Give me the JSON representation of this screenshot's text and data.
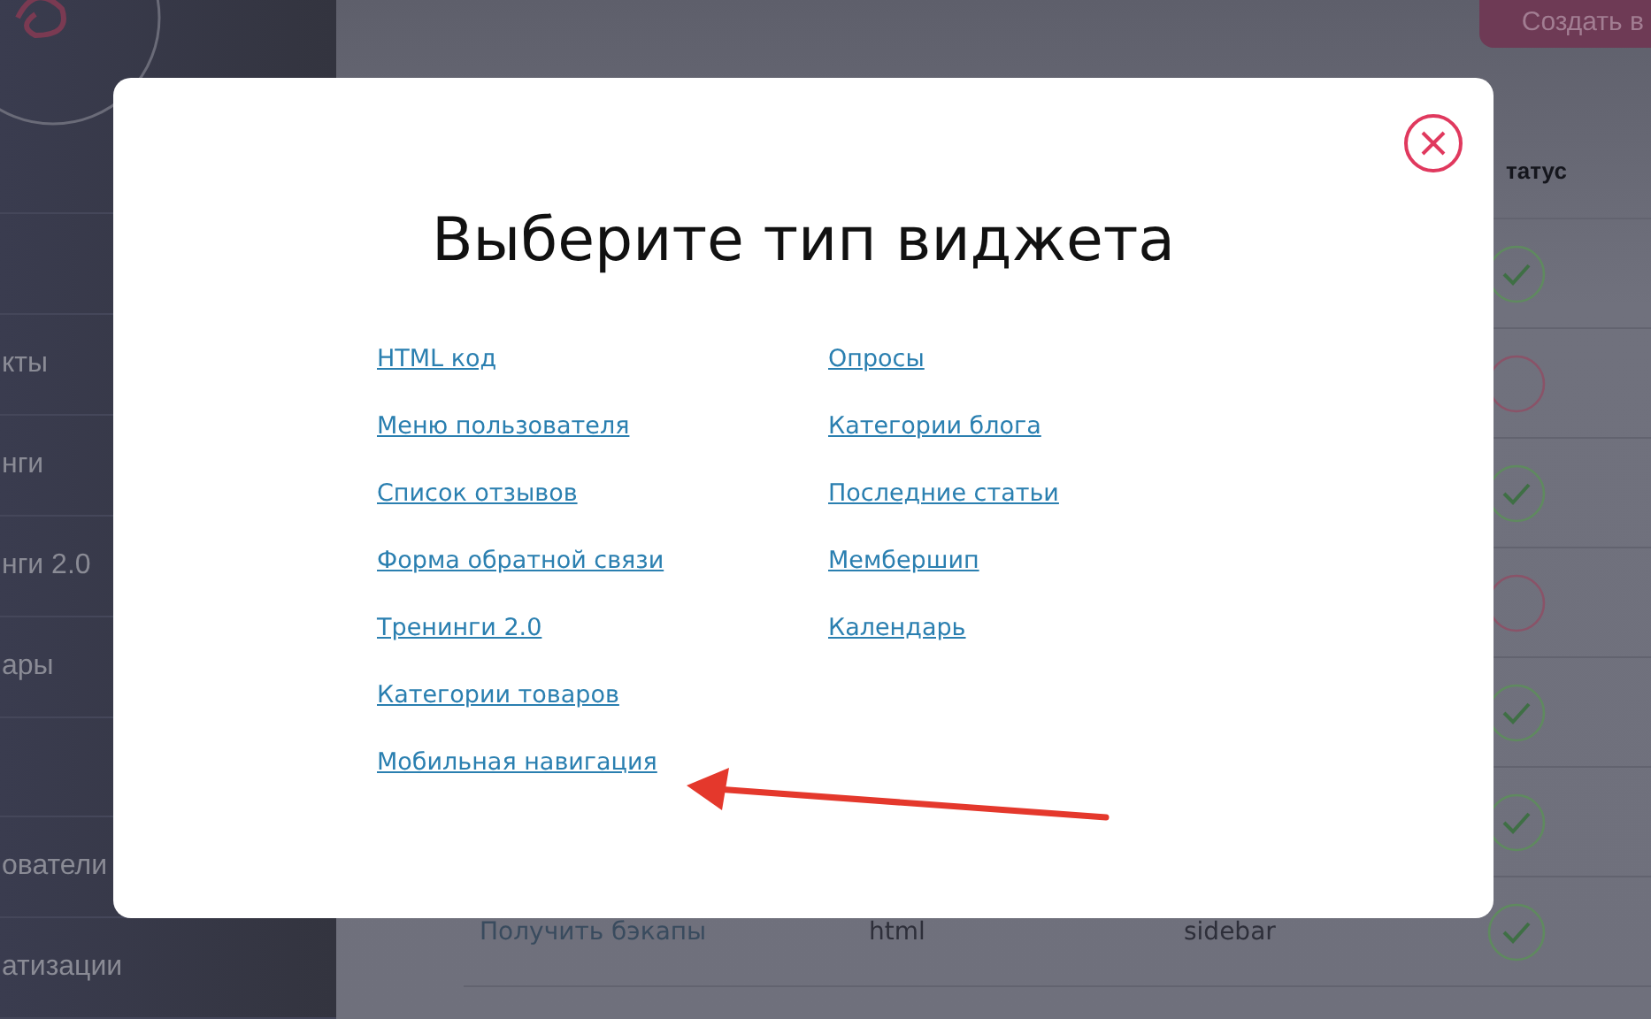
{
  "sidebar": {
    "groups": [
      [
        {
          "label": "кты"
        },
        {
          "label": "нги"
        },
        {
          "label": "нги 2.0"
        },
        {
          "label": "ары"
        }
      ],
      [
        {
          "label": "ователи"
        },
        {
          "label": "атизации"
        }
      ]
    ]
  },
  "top_bar": {
    "create_button": "Создать в"
  },
  "table": {
    "status_header": "татус",
    "rows": [
      {
        "active": true
      },
      {
        "active": false
      },
      {
        "active": true
      },
      {
        "active": false
      },
      {
        "active": true
      },
      {
        "active": true
      },
      {
        "name": "Получить бэкапы",
        "type": "html",
        "position": "sidebar",
        "active": true
      }
    ]
  },
  "dialog": {
    "title": "Выберите тип виджета",
    "columns": [
      [
        "HTML код",
        "Меню пользователя",
        "Список отзывов",
        "Форма обратной связи",
        "Тренинги 2.0",
        "Категории товаров",
        "Мобильная навигация"
      ],
      [
        "Опросы",
        "Категории блога",
        "Последние статьи",
        "Мембершип",
        "Календарь"
      ]
    ]
  }
}
